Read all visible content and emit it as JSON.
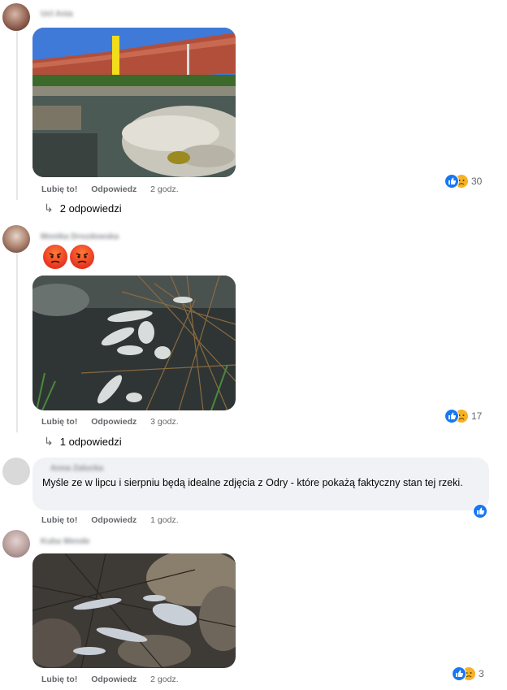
{
  "comments": [
    {
      "author": "Ucl Ania",
      "actions": {
        "like": "Lubię to!",
        "reply": "Odpowiedz",
        "time": "2 godz."
      },
      "reaction_count": "30",
      "replies_label": "2 odpowiedzi"
    },
    {
      "author": "Monika Drozdowska",
      "actions": {
        "like": "Lubię to!",
        "reply": "Odpowiedz",
        "time": "3 godz."
      },
      "reaction_count": "17",
      "replies_label": "1 odpowiedzi"
    },
    {
      "author": "Anna Zalucka",
      "text": "Myśle ze w lipcu i sierpniu będą idealne zdjęcia z Odry - które pokażą faktyczny stan tej rzeki.",
      "actions": {
        "like": "Lubię to!",
        "reply": "Odpowiedz",
        "time": "1 godz."
      }
    },
    {
      "author": "Kuba Wende",
      "actions": {
        "like": "Lubię to!",
        "reply": "Odpowiedz",
        "time": "2 godz."
      },
      "reaction_count": "3"
    }
  ],
  "colors": {
    "like": "#1877f2",
    "sad": "#f7b125",
    "angry": "#e8341f",
    "bubble": "#f0f2f5",
    "muted": "#65676b"
  },
  "icons": [
    "like-reaction-icon",
    "sad-reaction-icon",
    "angry-reaction-icon",
    "reply-arrow-icon"
  ]
}
